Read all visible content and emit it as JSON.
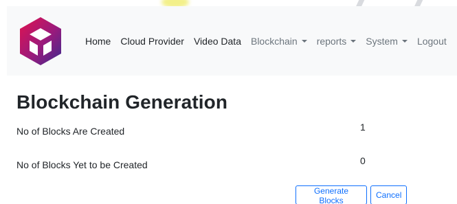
{
  "nav": {
    "items": [
      {
        "label": "Home"
      },
      {
        "label": "Cloud Provider"
      },
      {
        "label": "Video Data"
      },
      {
        "label": "Blockchain"
      },
      {
        "label": "reports"
      },
      {
        "label": "System"
      },
      {
        "label": "Logout"
      }
    ],
    "logo_colors": [
      "#e0134f",
      "#7b1f8c",
      "#3b2a8f"
    ]
  },
  "page": {
    "title": "Blockchain Generation",
    "rows": [
      {
        "label": "No of Blocks Are Created",
        "value": "1"
      },
      {
        "label": "No of Blocks Yet to be Created",
        "value": "0"
      }
    ]
  },
  "actions": {
    "generate_label": "Generate Blocks",
    "cancel_label": "Cancel"
  },
  "colors": {
    "navbar_bg": "#f8f9fa",
    "button_accent": "#0d6efd"
  }
}
